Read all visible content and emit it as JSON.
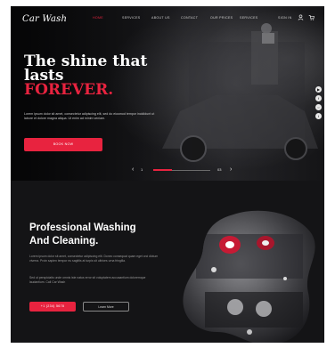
{
  "brand": {
    "logo": "Car Wash"
  },
  "nav": {
    "items": [
      {
        "label": "Home",
        "active": true
      },
      {
        "label": "Services",
        "active": false
      },
      {
        "label": "About Us",
        "active": false
      },
      {
        "label": "Contact",
        "active": false
      },
      {
        "label": "Our Prices",
        "active": false
      },
      {
        "label": "Services",
        "active": false
      }
    ],
    "signin": "Sign In",
    "icons": [
      "user-icon",
      "cart-icon"
    ]
  },
  "hero": {
    "headline_line1": "The shine that",
    "headline_line2": "lasts",
    "headline_accent": "FOREVER.",
    "description": "Lorem ipsum dolor sit amet, consectetur adipiscing elit, sed do eiusmod tempor incididunt ut labore et dolore magna aliqua. Ut enim ad minim veniam.",
    "cta_label": "Book Now",
    "slider": {
      "current": "1",
      "total": "03",
      "progress": 0.33
    }
  },
  "social": {
    "icons": [
      "youtube-icon",
      "facebook-icon",
      "instagram-icon",
      "twitter-icon"
    ]
  },
  "section2": {
    "title_line1": "Professional Washing",
    "title_line2": "And Cleaning.",
    "paragraph1": "Lorem ipsum dolor sit amet, consectetur adipiscing elit. Donec consequat quam eget orci dictum viverra. Proin sapien tempor eu sagittis at turpis sit ultrices urna fringilla.",
    "paragraph2": "Sed ut perspiciatis unde omnis iste natus error sit voluptatem accusantium doloremque laudantium. Call Car Wash",
    "btn_primary": "+1 (234) 5678",
    "btn_secondary": "Learn More"
  },
  "colors": {
    "accent": "#e8233f",
    "background": "#141416",
    "text": "#ffffff"
  }
}
